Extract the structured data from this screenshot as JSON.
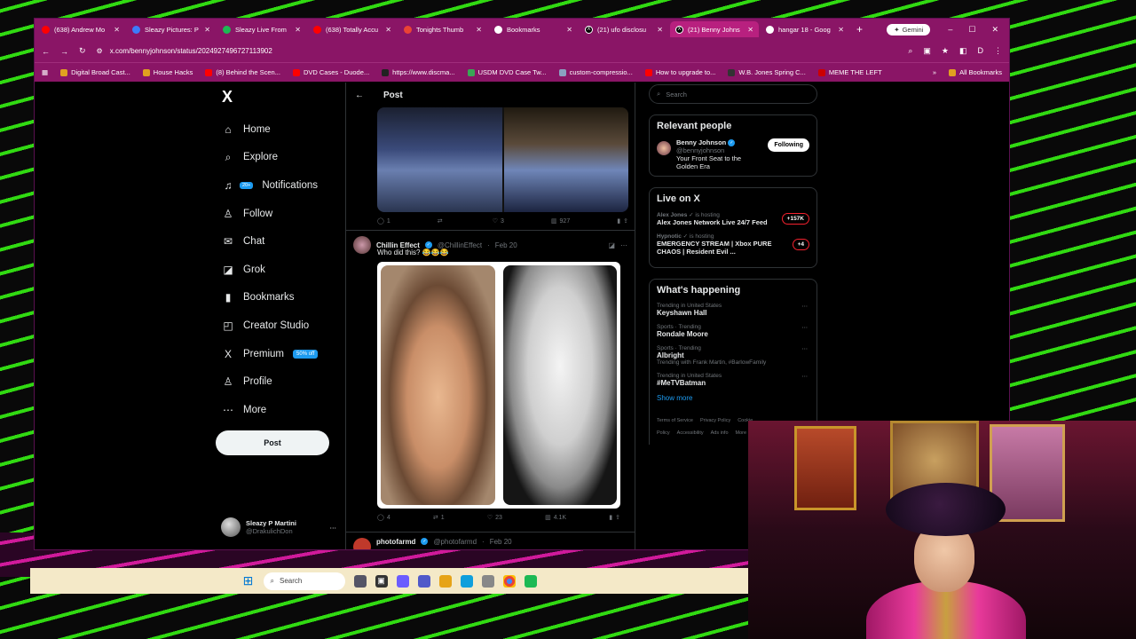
{
  "tabs": [
    {
      "label": "(638) Andrew Mo",
      "icon": "youtube-icon",
      "color": "#ff0000",
      "active": false
    },
    {
      "label": "Sleazy Pictures: P",
      "icon": "b-icon",
      "color": "#3d7bfa",
      "active": false
    },
    {
      "label": "Sleazy Live From",
      "icon": "play-icon",
      "color": "#1db954",
      "active": false
    },
    {
      "label": "(638) Totally Accu",
      "icon": "youtube-icon",
      "color": "#ff0000",
      "active": false
    },
    {
      "label": "Tonights Thumb",
      "icon": "gmail-icon",
      "color": "#ea4335",
      "active": false
    },
    {
      "label": "Bookmarks",
      "icon": "star-icon",
      "color": "#ffffff",
      "active": false
    },
    {
      "label": "(21) ufo disclosu",
      "icon": "x-icon",
      "color": "#000000",
      "active": false
    },
    {
      "label": "(21) Benny Johns",
      "icon": "x-icon",
      "color": "#000000",
      "active": true
    },
    {
      "label": "hangar 18 - Goog",
      "icon": "google-icon",
      "color": "#ffffff",
      "active": false
    }
  ],
  "gemini": "Gemini",
  "url": "x.com/bennyjohnson/status/2024927496727113902",
  "bookmarks": [
    {
      "label": "Digital Broad Cast...",
      "color": "#e0a020"
    },
    {
      "label": "House Hacks",
      "color": "#e0a020"
    },
    {
      "label": "(8) Behind the Scen...",
      "color": "#ff0000"
    },
    {
      "label": "DVD Cases - Duode...",
      "color": "#ff0000"
    },
    {
      "label": "https://www.discma...",
      "color": "#222222"
    },
    {
      "label": "USDM DVD Case Tw...",
      "color": "#3aa655"
    },
    {
      "label": "custom-compressio...",
      "color": "#8aa0c0"
    },
    {
      "label": "How to upgrade to...",
      "color": "#ff0000"
    },
    {
      "label": "W.B. Jones Spring C...",
      "color": "#333333"
    },
    {
      "label": "MEME THE LEFT",
      "color": "#cc0000"
    }
  ],
  "all_bookmarks": "All Bookmarks",
  "x_logo": "X",
  "nav": [
    {
      "label": "Home",
      "icon": "⌂",
      "name": "home-icon"
    },
    {
      "label": "Explore",
      "icon": "⌕",
      "name": "search-icon"
    },
    {
      "label": "Notifications",
      "icon": "♫",
      "name": "bell-icon",
      "badge": "20+"
    },
    {
      "label": "Follow",
      "icon": "♙",
      "name": "follow-icon"
    },
    {
      "label": "Chat",
      "icon": "✉",
      "name": "chat-icon"
    },
    {
      "label": "Grok",
      "icon": "◪",
      "name": "grok-icon"
    },
    {
      "label": "Bookmarks",
      "icon": "▮",
      "name": "bookmark-icon"
    },
    {
      "label": "Creator Studio",
      "icon": "◰",
      "name": "creator-icon"
    },
    {
      "label": "Premium",
      "icon": "X",
      "name": "premium-icon",
      "promo": "50% off"
    },
    {
      "label": "Profile",
      "icon": "♙",
      "name": "profile-icon"
    },
    {
      "label": "More",
      "icon": "⋯",
      "name": "more-icon"
    }
  ],
  "post_button": "Post",
  "account": {
    "name": "Sleazy P Martini",
    "handle": "@DrakulichDon"
  },
  "feed": {
    "title": "Post",
    "tweet1_actions": {
      "replies": "1",
      "reposts": "",
      "likes": "3",
      "views": "927"
    },
    "tweet2": {
      "name": "Chillin Effect",
      "handle": "@ChillinEffect",
      "date": "Feb 20",
      "text": "Who did this? 😂😂😂",
      "actions": {
        "replies": "4",
        "reposts": "1",
        "likes": "23",
        "views": "4.1K"
      }
    },
    "tweet3": {
      "name": "photofarmd",
      "handle": "@photofarmd",
      "date": "Feb 20"
    }
  },
  "right": {
    "search_placeholder": "Search",
    "relevant_title": "Relevant people",
    "person": {
      "name": "Benny Johnson",
      "handle": "@bennyjohnson",
      "bio": "Your Front Seat to the Golden Era",
      "button": "Following"
    },
    "live_title": "Live on X",
    "live": [
      {
        "host": "Alex Jones",
        "hosting": "is hosting",
        "title": "Alex Jones Network Live 24/7 Feed",
        "count": "+157K"
      },
      {
        "host": "Hypnotic",
        "hosting": "is hosting",
        "title": "EMERGENCY STREAM | Xbox PURE CHAOS | Resident Evil ...",
        "count": "+4"
      }
    ],
    "happening_title": "What's happening",
    "trends": [
      {
        "meta": "Trending in United States",
        "topic": "Keyshawn Hall",
        "extra": ""
      },
      {
        "meta": "Sports · Trending",
        "topic": "Rondale Moore",
        "extra": ""
      },
      {
        "meta": "Sports · Trending",
        "topic": "Albright",
        "extra": "Trending with Frank Martin, #BarlowFamily"
      },
      {
        "meta": "Trending in United States",
        "topic": "#MeTVBatman",
        "extra": ""
      }
    ],
    "show_more": "Show more",
    "footer": [
      "Terms of Service",
      "Privacy Policy",
      "Cookie Policy",
      "Accessibility",
      "Ads info",
      "More ..."
    ]
  },
  "taskbar": {
    "search": "Search"
  }
}
